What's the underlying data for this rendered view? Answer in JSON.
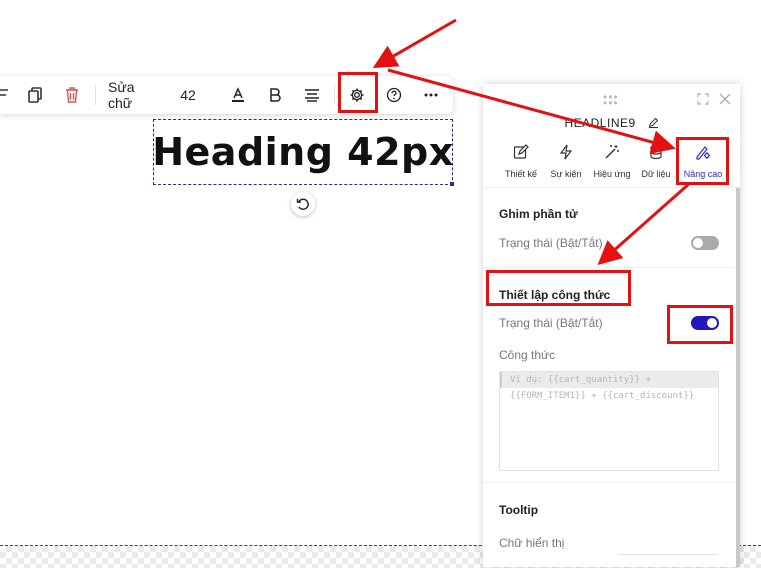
{
  "toolbar": {
    "edit_text_label": "Sửa chữ",
    "font_size_value": "42",
    "icons": [
      "copy-icon",
      "trash-icon",
      "text-color-icon",
      "bold-icon",
      "align-icon",
      "settings-icon",
      "help-icon",
      "more-icon"
    ]
  },
  "canvas": {
    "heading_text": "Heading 42px"
  },
  "panel": {
    "title": "HEADLINE9",
    "tabs": [
      {
        "label": "Thiết kế",
        "icon": "edit-icon"
      },
      {
        "label": "Sự kiện",
        "icon": "lightning-icon"
      },
      {
        "label": "Hiệu ứng",
        "icon": "magic-wand-icon"
      },
      {
        "label": "Dữ liệu",
        "icon": "database-icon"
      },
      {
        "label": "Nâng cao",
        "icon": "advanced-settings-icon"
      }
    ],
    "active_tab": "Nâng cao",
    "pin_section": {
      "title": "Ghim phần tử",
      "status_label": "Trạng thái (Bật/Tắt)",
      "enabled": false
    },
    "formula_section": {
      "title": "Thiết lập công thức",
      "status_label": "Trạng thái (Bật/Tắt)",
      "enabled": true,
      "formula_label": "Công thức",
      "placeholder_line1": "Ví dụ: {{cart_quantity}} +",
      "placeholder_line2": "{{FORM_ITEM1}} + {{cart_discount}}"
    },
    "tooltip_section": {
      "title": "Tooltip",
      "display_text_label": "Chữ hiển thị"
    }
  },
  "colors": {
    "accent": "#2417b8",
    "annotation_red": "#e31111",
    "active_tab": "#2b2bd1"
  }
}
